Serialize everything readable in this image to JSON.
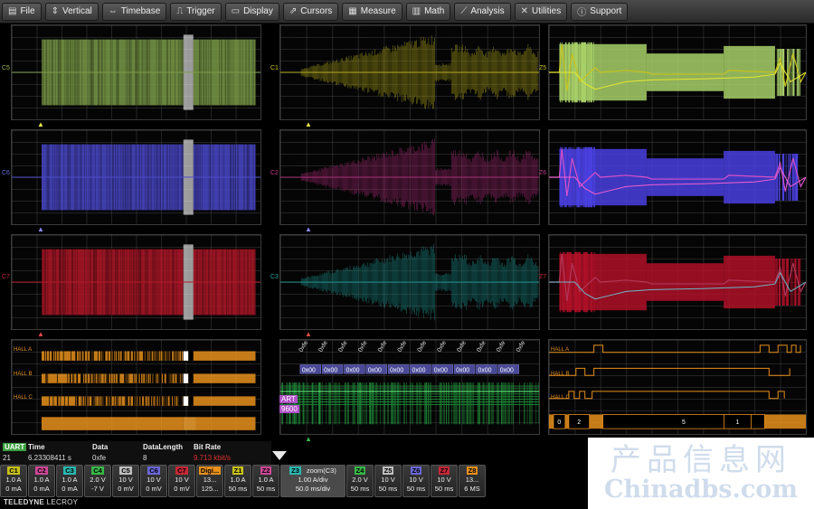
{
  "menu": [
    {
      "icon": "file-icon",
      "glyph": "▤",
      "label": "File"
    },
    {
      "icon": "vertical-icon",
      "glyph": "⇕",
      "label": "Vertical"
    },
    {
      "icon": "timebase-icon",
      "glyph": "⇔",
      "label": "Timebase"
    },
    {
      "icon": "trigger-icon",
      "glyph": "⎍",
      "label": "Trigger"
    },
    {
      "icon": "display-icon",
      "glyph": "▭",
      "label": "Display"
    },
    {
      "icon": "cursors-icon",
      "glyph": "⇗",
      "label": "Cursors"
    },
    {
      "icon": "measure-icon",
      "glyph": "▦",
      "label": "Measure"
    },
    {
      "icon": "math-icon",
      "glyph": "▥",
      "label": "Math"
    },
    {
      "icon": "analysis-icon",
      "glyph": "⟋",
      "label": "Analysis"
    },
    {
      "icon": "utilities-icon",
      "glyph": "✕",
      "label": "Utilities"
    },
    {
      "icon": "support-icon",
      "glyph": "ⓘ",
      "label": "Support"
    }
  ],
  "colors": {
    "C1": "#c8c21c",
    "C2": "#c8388c",
    "C3": "#2aa8a0",
    "C4": "#38b848",
    "C5": "#9ab85a",
    "C6": "#5a58d8",
    "C7": "#c82838",
    "digital": "#e8901c",
    "Z5": "#a8d068",
    "Z6": "#5a50e0",
    "Z7": "#c01830"
  },
  "traces": {
    "c5": "C5",
    "c6": "C6",
    "c7": "C7",
    "c1": "C1",
    "c2": "C2",
    "c3": "C3",
    "z5": "Z5",
    "z6": "Z6",
    "z7": "Z7"
  },
  "hall": {
    "a": "HALL A",
    "b": "HALL B",
    "c": "HALL C"
  },
  "decode": {
    "bytes": [
      "0xfe",
      "0xfe",
      "0xfe",
      "0xfe",
      "0xfe",
      "0xfe",
      "0xfe",
      "0xfe",
      "0xfe",
      "0xfe",
      "0xfe",
      "0xfe"
    ],
    "values": [
      "0x00",
      "0x00",
      "0x00",
      "0x00",
      "0x00",
      "0x00",
      "0x00",
      "0x00",
      "0x00",
      "0x00"
    ],
    "label": "ART",
    "baud": "9600",
    "sidebar": "UART"
  },
  "digital_right": {
    "values": [
      "0",
      "2",
      "5",
      "1"
    ]
  },
  "table": {
    "headers": {
      "src": "UART",
      "time": "Time",
      "data": "Data",
      "len": "DataLength",
      "rate": "Bit Rate"
    },
    "row": {
      "idx": "21",
      "time": "6.23308411 s",
      "data": "0xfe",
      "len": "8",
      "rate": "9.713 kbit/s"
    }
  },
  "channels": [
    {
      "tag": "C1",
      "color": "#c8c21c",
      "l1": "1.0 A",
      "l2": "0 mA"
    },
    {
      "tag": "C2",
      "color": "#d04898",
      "l1": "1.0 A",
      "l2": "0 mA"
    },
    {
      "tag": "C3",
      "color": "#2ab8b0",
      "l1": "1.0 A",
      "l2": "0 mA"
    },
    {
      "tag": "C4",
      "color": "#38b848",
      "l1": "2.0 V",
      "l2": "-7 V"
    },
    {
      "tag": "C5",
      "color": "#c0c0c0",
      "l1": "10 V",
      "l2": "0 mV"
    },
    {
      "tag": "C6",
      "color": "#6a68d8",
      "l1": "10 V",
      "l2": "0 mV"
    },
    {
      "tag": "C7",
      "color": "#c82838",
      "l1": "10 V",
      "l2": "0 mV"
    },
    {
      "tag": "Digi...",
      "color": "#e8901c",
      "l1": "13...",
      "l2": "125..."
    },
    {
      "tag": "Z1",
      "color": "#c8c21c",
      "l1": "1.0 A",
      "l2": "50 ms"
    },
    {
      "tag": "Z2",
      "color": "#d04898",
      "l1": "1.0 A",
      "l2": "50 ms"
    },
    {
      "tag": "Z3",
      "color": "#2ab8b0",
      "l1": "zoom(C3)",
      "l2": "1.00 A/div",
      "l3": "50.0 ms/div"
    },
    {
      "tag": "Z4",
      "color": "#38b848",
      "l1": "2.0 V",
      "l2": "50 ms"
    },
    {
      "tag": "Z5",
      "color": "#c0c0c0",
      "l1": "10 V",
      "l2": "50 ms"
    },
    {
      "tag": "Z6",
      "color": "#6a68d8",
      "l1": "10 V",
      "l2": "50 ms"
    },
    {
      "tag": "Z7",
      "color": "#c82838",
      "l1": "10 V",
      "l2": "50 ms"
    },
    {
      "tag": "Z8",
      "color": "#e8901c",
      "l1": "13...",
      "l2": "6 MS"
    }
  ],
  "brand": {
    "name": "TELEDYNE",
    "sub": "LECROY"
  },
  "watermark": {
    "line1": "产品信息网",
    "line2": "Chinadbs.com"
  }
}
